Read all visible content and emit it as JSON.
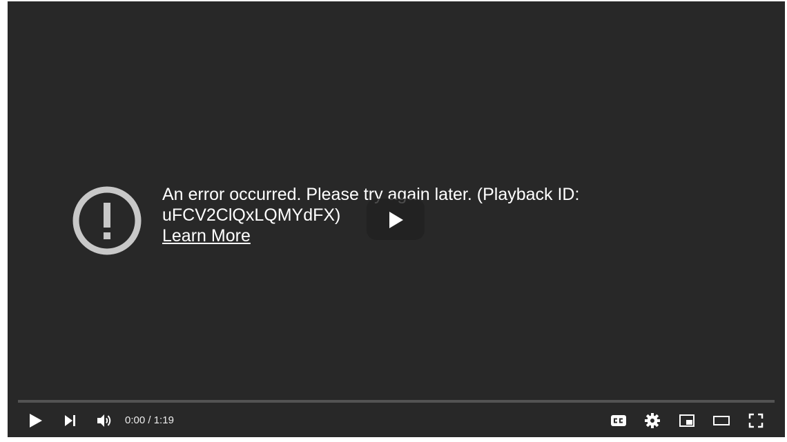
{
  "error": {
    "message": "An error occurred. Please try again later. (Playback ID: uFCV2ClQxLQMYdFX)",
    "link_label": "Learn More"
  },
  "player": {
    "current_time": "0:00",
    "separator": " / ",
    "duration": "1:19",
    "progress": 0
  },
  "icons": {
    "error": "exclamation-circle-icon",
    "big_play": "play-icon",
    "play": "play-icon",
    "next": "skip-next-icon",
    "volume": "volume-icon",
    "captions": "cc-icon",
    "settings": "gear-icon",
    "miniplayer": "miniplayer-icon",
    "theater": "theater-mode-icon",
    "fullscreen": "fullscreen-icon"
  },
  "colors": {
    "player_background": "#282828",
    "text": "#ffffff",
    "icon_gray": "#c8c8c8"
  }
}
